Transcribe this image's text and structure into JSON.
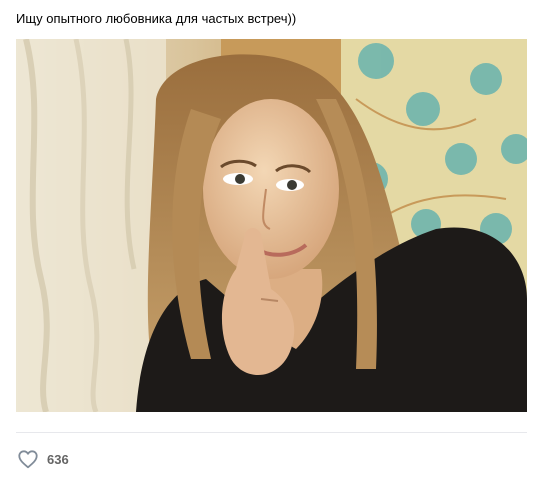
{
  "post": {
    "text": "Ищу опытного любовника для частых встреч))",
    "photo": {
      "icon": "selfie-photo",
      "colors": {
        "wallpaper": "#e4d9a4",
        "flower": "#6fb5ad",
        "hair": "#b48a55",
        "shirt": "#1d1a18"
      }
    },
    "likes": {
      "icon": "heart-outline-icon",
      "count": "636"
    }
  },
  "colors": {
    "text": "#000000",
    "muted": "#656565",
    "divider": "#e7e8ec",
    "icon": "#818c99"
  }
}
